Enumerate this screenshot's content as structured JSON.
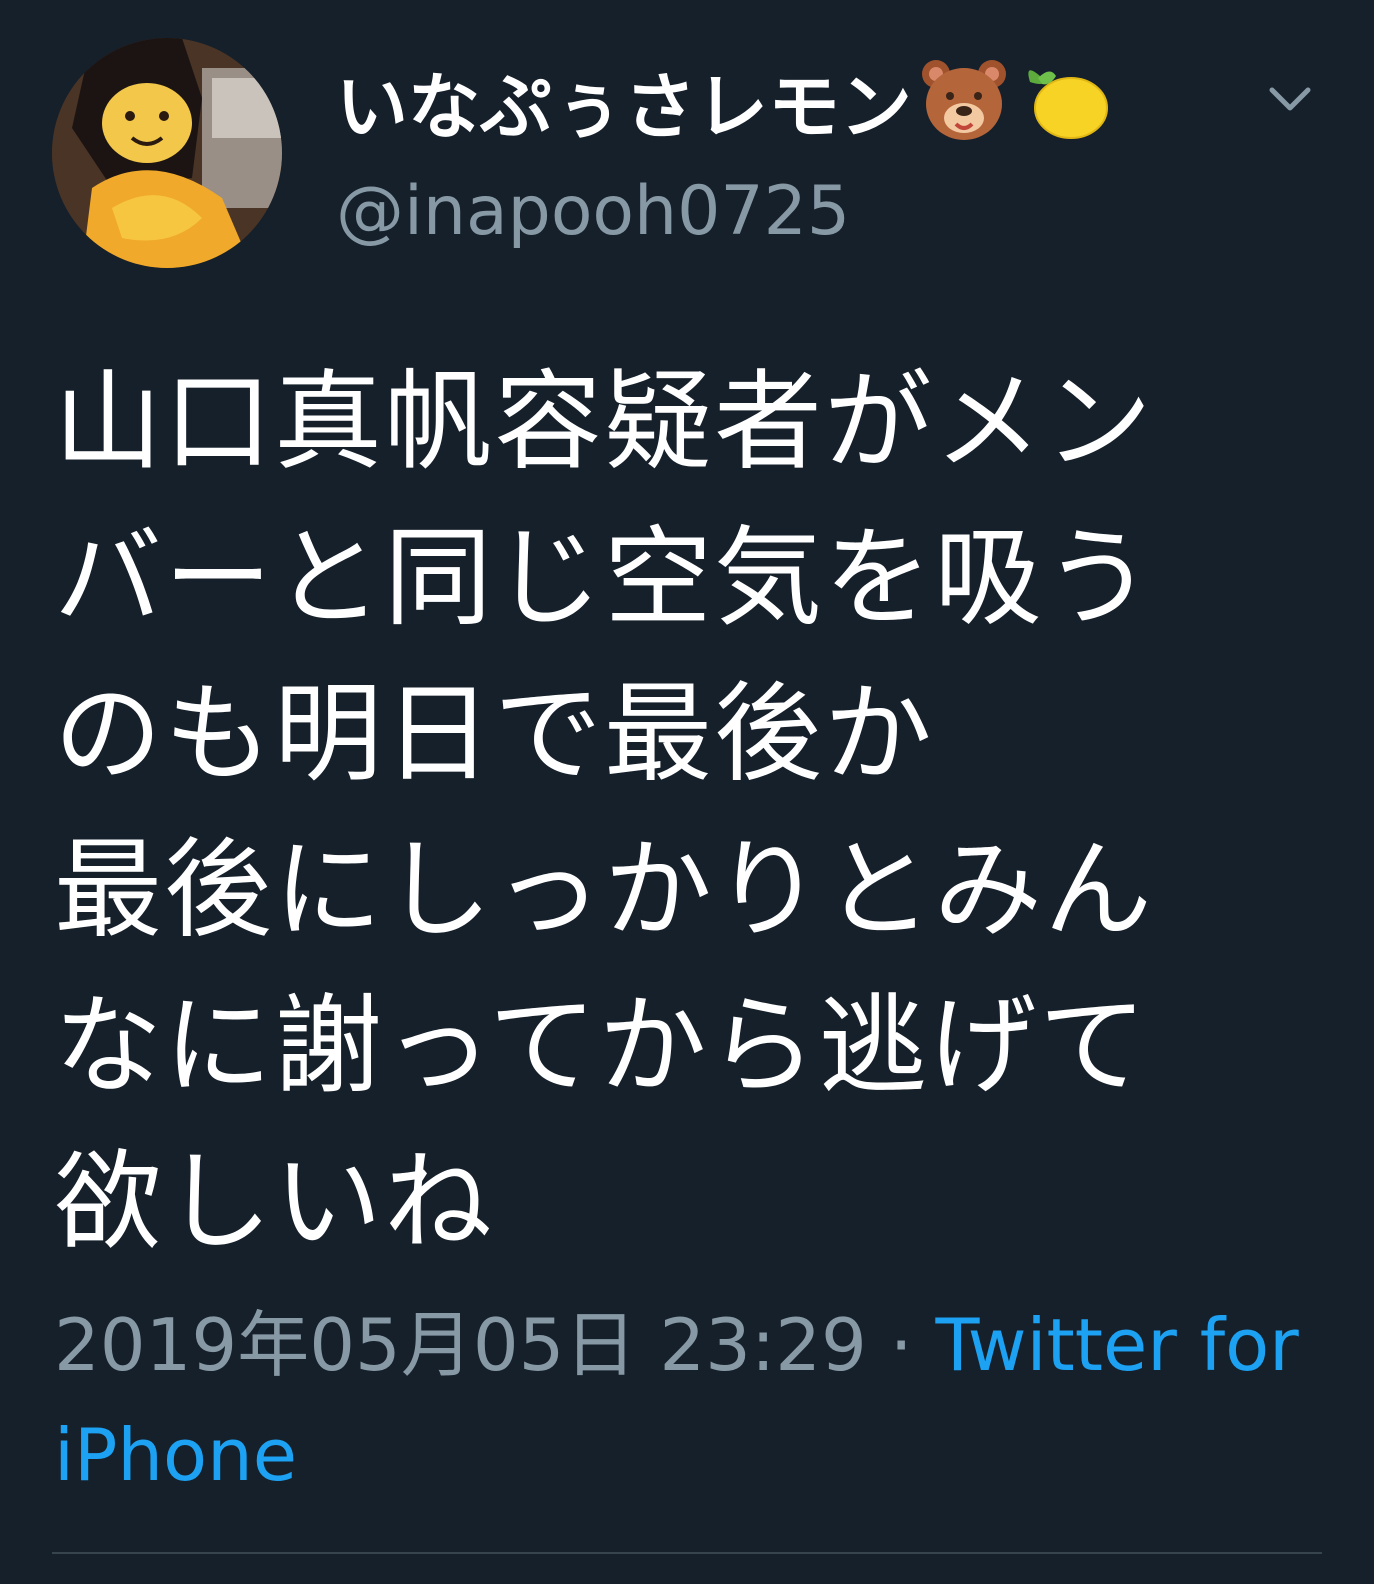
{
  "tweet": {
    "author": {
      "display_name": "いなぷぅさレモン",
      "name_emojis": [
        "bear-face-emoji",
        "lemon-emoji"
      ],
      "handle": "@inapooh0725",
      "avatar": "profile-avatar"
    },
    "menu_icon": "chevron-down-icon",
    "text_lines": [
      "山口真帆容疑者がメン",
      "バーと同じ空気を吸う",
      "のも明日で最後か",
      "最後にしっかりとみん",
      "なに謝ってから逃げて",
      "欲しいね"
    ],
    "timestamp": "2019年05月05日 23:29",
    "separator": " · ",
    "source": "Twitter for iPhone"
  },
  "colors": {
    "background": "#15202b",
    "primary_text": "#ffffff",
    "secondary_text": "#8899a6",
    "link": "#1da1f2",
    "divider": "#38444d"
  }
}
